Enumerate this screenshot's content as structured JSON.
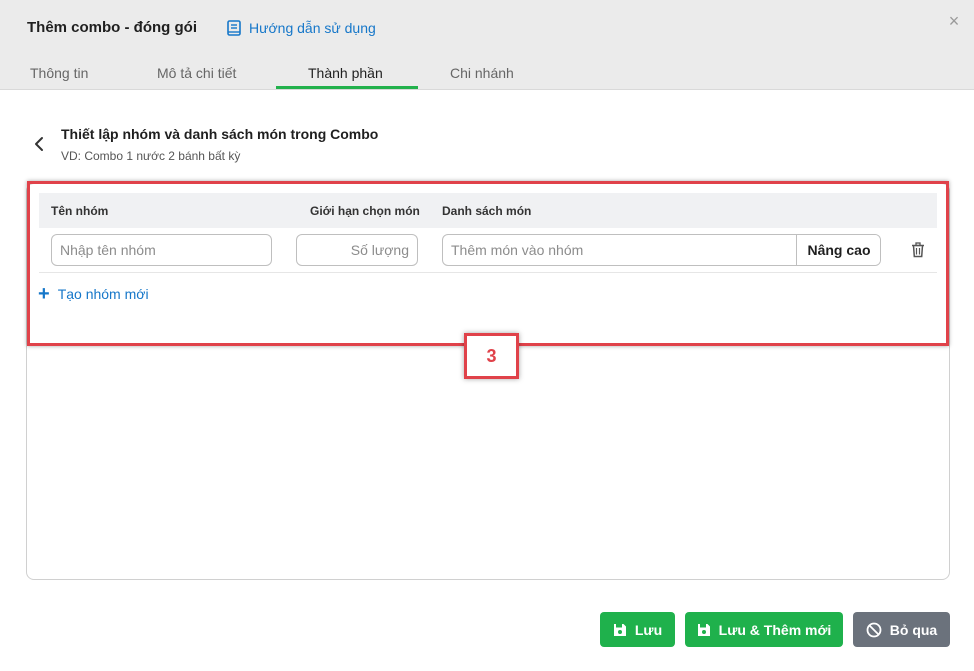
{
  "modal": {
    "title": "Thêm combo - đóng gói",
    "guide_label": "Hướng dẫn sử dụng",
    "close_label": "×"
  },
  "tabs": [
    {
      "label": "Thông tin",
      "active": false
    },
    {
      "label": "Mô tả chi tiết",
      "active": false
    },
    {
      "label": "Thành phần",
      "active": true
    },
    {
      "label": "Chi nhánh",
      "active": false
    }
  ],
  "section": {
    "title": "Thiết lập nhóm và danh sách món trong Combo",
    "subtitle": "VD: Combo 1 nước 2 bánh bất kỳ"
  },
  "table": {
    "headers": [
      "Tên nhóm",
      "Giới hạn chọn món",
      "Danh sách món"
    ],
    "row": {
      "group_name_value": "",
      "group_name_placeholder": "Nhập tên nhóm",
      "limit_value": "",
      "limit_placeholder": "Số lượng",
      "dishes_value": "",
      "dishes_placeholder": "Thêm món vào nhóm",
      "advanced_label": "Nâng cao",
      "delete_icon": "trash-icon"
    },
    "add_group_label": "Tạo nhóm mới"
  },
  "annotation": {
    "callout_number": "3",
    "color": "#e0424a"
  },
  "footer": {
    "save_label": "Lưu",
    "save_new_label": "Lưu & Thêm mới",
    "cancel_label": "Bỏ qua"
  },
  "colors": {
    "accent_green": "#1fb14c",
    "link_blue": "#1677c9",
    "cancel_gray": "#6b727c"
  }
}
